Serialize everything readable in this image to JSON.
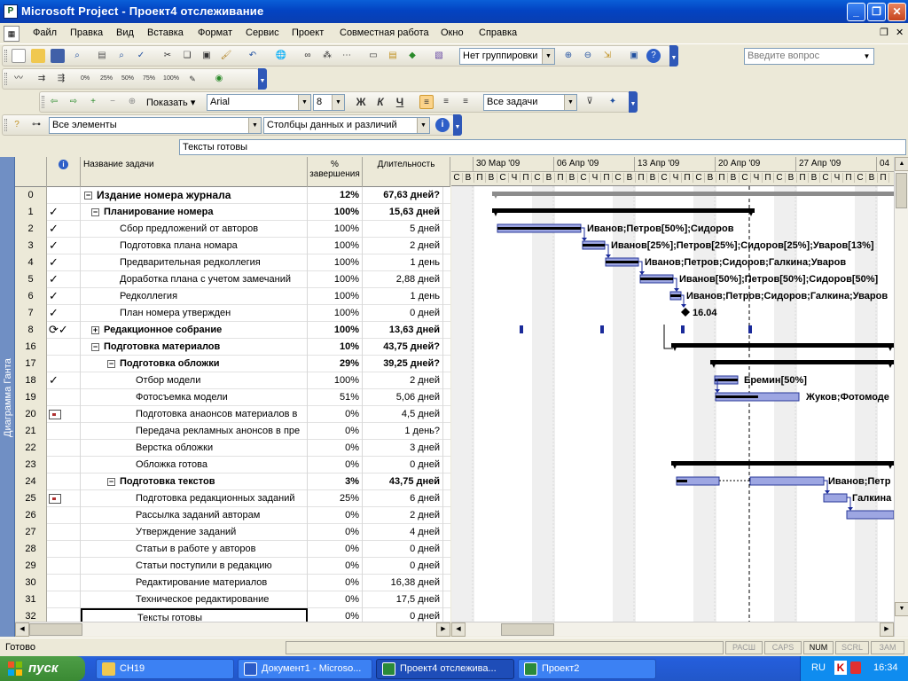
{
  "window": {
    "title": "Microsoft Project - Проект4 отслеживание"
  },
  "menu": [
    "Файл",
    "Правка",
    "Вид",
    "Вставка",
    "Формат",
    "Сервис",
    "Проект",
    "Совместная работа",
    "Окно",
    "Справка"
  ],
  "help": {
    "placeholder": "Введите вопрос"
  },
  "toolbar1": {
    "grouping": "Нет группировки"
  },
  "toolbar2": {
    "pct_buttons": [
      "0%",
      "25%",
      "50%",
      "75%",
      "100%"
    ]
  },
  "toolbar3": {
    "show_label": "Показать",
    "font": "Arial",
    "size": "8",
    "bold": "Ж",
    "italic": "К",
    "underline": "Ч",
    "filter": "Все задачи"
  },
  "toolbar4": {
    "elements": "Все элементы",
    "columns": "Столбцы данных и различий"
  },
  "entry_bar": {
    "value": "Тексты готовы"
  },
  "view_bar": {
    "label": "Диаграмма Ганта"
  },
  "table": {
    "headers": {
      "name": "Название задачи",
      "pct": "% завершения",
      "duration": "Длительность"
    },
    "rows": [
      {
        "id": "0",
        "ind": "",
        "name": "Издание номера журнала",
        "pct": "12%",
        "dur": "67,63 дней?",
        "level": 0,
        "bold": true,
        "summary": true
      },
      {
        "id": "1",
        "ind": "check",
        "name": "Планирование номера",
        "pct": "100%",
        "dur": "15,63 дней",
        "level": 1,
        "bold": true,
        "summary": true
      },
      {
        "id": "2",
        "ind": "check",
        "name": "Сбор предложений от авторов",
        "pct": "100%",
        "dur": "5 дней",
        "level": 2
      },
      {
        "id": "3",
        "ind": "check",
        "name": "Подготовка плана номара",
        "pct": "100%",
        "dur": "2 дней",
        "level": 2
      },
      {
        "id": "4",
        "ind": "check",
        "name": "Предварительная редколлегия",
        "pct": "100%",
        "dur": "1 день",
        "level": 2
      },
      {
        "id": "5",
        "ind": "check",
        "name": "Доработка плана с учетом замечаний",
        "pct": "100%",
        "dur": "2,88 дней",
        "level": 2
      },
      {
        "id": "6",
        "ind": "check",
        "name": "Редколлегия",
        "pct": "100%",
        "dur": "1 день",
        "level": 2
      },
      {
        "id": "7",
        "ind": "check",
        "name": "План номера утвержден",
        "pct": "100%",
        "dur": "0 дней",
        "level": 2
      },
      {
        "id": "8",
        "ind": "recur",
        "name": "Редакционное собрание",
        "pct": "100%",
        "dur": "13,63 дней",
        "level": 1,
        "bold": true,
        "collapsed": true
      },
      {
        "id": "16",
        "ind": "",
        "name": "Подготовка материалов",
        "pct": "10%",
        "dur": "43,75 дней?",
        "level": 1,
        "bold": true,
        "summary": true
      },
      {
        "id": "17",
        "ind": "",
        "name": "Подготовка обложки",
        "pct": "29%",
        "dur": "39,25 дней?",
        "level": 2,
        "bold": true,
        "summary": true
      },
      {
        "id": "18",
        "ind": "check",
        "name": "Отбор модели",
        "pct": "100%",
        "dur": "2 дней",
        "level": 3
      },
      {
        "id": "19",
        "ind": "",
        "name": "Фотосъемка модели",
        "pct": "51%",
        "dur": "5,06 дней",
        "level": 3
      },
      {
        "id": "20",
        "ind": "note",
        "name": "Подготовка анаонсов материалов в",
        "pct": "0%",
        "dur": "4,5 дней",
        "level": 3
      },
      {
        "id": "21",
        "ind": "",
        "name": "Передача рекламных анонсов в пре",
        "pct": "0%",
        "dur": "1 день?",
        "level": 3
      },
      {
        "id": "22",
        "ind": "",
        "name": "Верстка обложки",
        "pct": "0%",
        "dur": "3 дней",
        "level": 3
      },
      {
        "id": "23",
        "ind": "",
        "name": "Обложка готова",
        "pct": "0%",
        "dur": "0 дней",
        "level": 3
      },
      {
        "id": "24",
        "ind": "",
        "name": "Подготовка текстов",
        "pct": "3%",
        "dur": "43,75 дней",
        "level": 2,
        "bold": true,
        "summary": true
      },
      {
        "id": "25",
        "ind": "note",
        "name": "Подготовка редакционных заданий",
        "pct": "25%",
        "dur": "6 дней",
        "level": 3
      },
      {
        "id": "26",
        "ind": "",
        "name": "Рассылка заданий авторам",
        "pct": "0%",
        "dur": "2 дней",
        "level": 3
      },
      {
        "id": "27",
        "ind": "",
        "name": "Утверждение заданий",
        "pct": "0%",
        "dur": "4 дней",
        "level": 3
      },
      {
        "id": "28",
        "ind": "",
        "name": "Статьи в работе у авторов",
        "pct": "0%",
        "dur": "0 дней",
        "level": 3
      },
      {
        "id": "29",
        "ind": "",
        "name": "Статьи поступили в редакцию",
        "pct": "0%",
        "dur": "0 дней",
        "level": 3
      },
      {
        "id": "30",
        "ind": "",
        "name": "Редактирование материалов",
        "pct": "0%",
        "dur": "16,38 дней",
        "level": 3
      },
      {
        "id": "31",
        "ind": "",
        "name": "Техническое редактирование",
        "pct": "0%",
        "dur": "17,5 дней",
        "level": 3
      },
      {
        "id": "32",
        "ind": "",
        "name": "Тексты готовы",
        "pct": "0%",
        "dur": "0 дней",
        "level": 3,
        "selected": true
      }
    ]
  },
  "gantt": {
    "weeks": [
      "30 Мар '09",
      "06 Апр '09",
      "13 Апр '09",
      "20 Апр '09",
      "27 Апр '09",
      "04"
    ],
    "days": [
      "С",
      "В",
      "П",
      "В",
      "С",
      "Ч",
      "П",
      "С",
      "В",
      "П",
      "В",
      "С",
      "Ч",
      "П",
      "С",
      "В",
      "П",
      "В",
      "С",
      "Ч",
      "П",
      "С",
      "В",
      "П",
      "В",
      "С",
      "Ч",
      "П",
      "С",
      "В",
      "П",
      "В",
      "С",
      "Ч",
      "П",
      "С",
      "В",
      "П"
    ],
    "labels": {
      "t2": "Иванов;Петров[50%];Сидоров",
      "t3": "Иванов[25%];Петров[25%];Сидоров[25%];Уваров[13%]",
      "t4": "Иванов;Петров;Сидоров;Галкина;Уваров",
      "t5": "Иванов[50%];Петров[50%];Сидоров[50%]",
      "t6": "Иванов;Петров;Сидоров;Галкина;Уваров",
      "t7": "16.04",
      "t18": "Еремин[50%]",
      "t19": "Жуков;Фотомоде",
      "t25": "Иванов;Петр",
      "t26": "Галкина"
    }
  },
  "status": {
    "text": "Готово",
    "indicators": [
      "РАСШ",
      "CAPS",
      "NUM",
      "SCRL",
      "ЗАМ"
    ],
    "active": "NUM"
  },
  "taskbar": {
    "start": "пуск",
    "buttons": [
      "CH19",
      "Документ1 - Microso...",
      "Проект4 отслежива...",
      "Проект2"
    ],
    "lang": "RU",
    "time": "16:34"
  }
}
